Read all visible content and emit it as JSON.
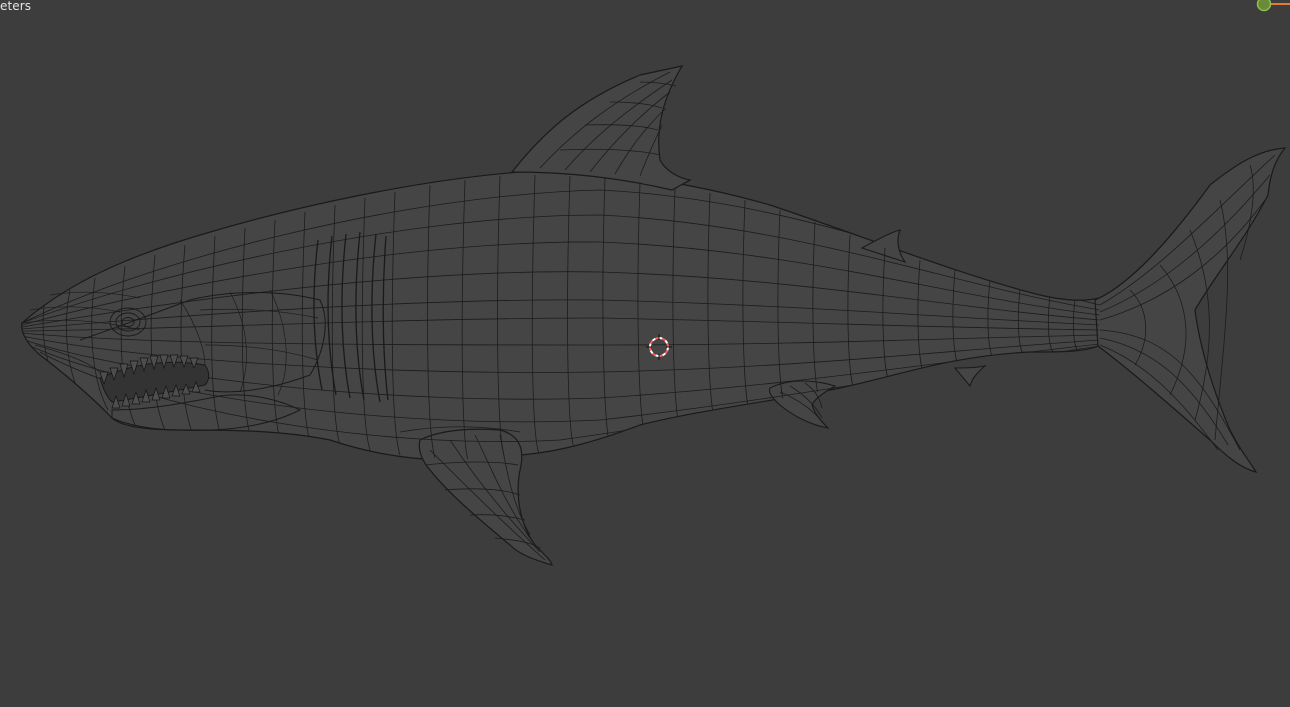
{
  "viewport": {
    "units_text": "eters",
    "background": "#3d3d3d",
    "wire_color": "#1a1a1a",
    "mesh_fill": "#4a4a4a"
  },
  "gizmo": {
    "y_axis_color": "#8bc34a",
    "x_axis_color": "#e07b39"
  },
  "object": {
    "icon": "shark-mesh",
    "display_mode": "wireframe"
  },
  "cursor": {
    "icon": "3d-cursor-icon",
    "ring_color_a": "#ff5a5a",
    "ring_color_b": "#ffffff"
  }
}
